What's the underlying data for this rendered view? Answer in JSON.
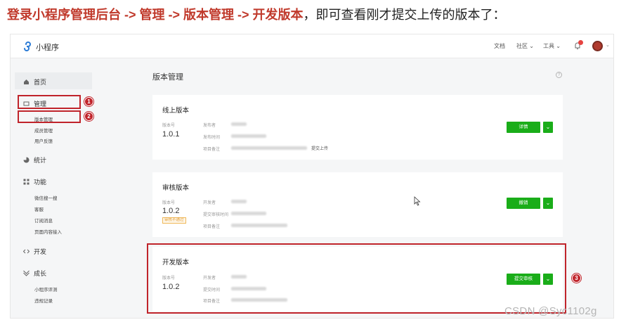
{
  "caption": {
    "part1": "登录小程序管理后台",
    "sep1": " -> ",
    "part2": "管理",
    "sep2": " -> ",
    "part3": "版本管理",
    "sep3": " -> ",
    "part4": "开发版本",
    "tail": "，即可查看刚才提交上传的版本了："
  },
  "topbar": {
    "brand": "小程序",
    "nav": [
      "文档",
      "社区",
      "工具"
    ]
  },
  "sidebar": {
    "home": "首页",
    "manage": "管理",
    "manage_sub": [
      "版本管理",
      "成员管理",
      "用户反馈"
    ],
    "stats": "统计",
    "features": "功能",
    "features_sub": [
      "微信搜一搜",
      "客服",
      "订阅消息",
      "页面内容接入"
    ],
    "dev": "开发",
    "growth": "成长",
    "growth_sub": [
      "小程序评测",
      "违规记录"
    ]
  },
  "main": {
    "title": "版本管理",
    "online": {
      "title": "线上版本",
      "ver_label": "版本号",
      "ver": "1.0.1",
      "fields": [
        "发布者",
        "发布时间",
        "项目备注"
      ],
      "note_suffix": "提交上传",
      "button": "详情"
    },
    "review": {
      "title": "审核版本",
      "ver_label": "版本号",
      "ver": "1.0.2",
      "badge": "审核不通过",
      "fields": [
        "开发者",
        "提交审核时间",
        "项目备注"
      ],
      "button": "撤销"
    },
    "dev": {
      "title": "开发版本",
      "ver_label": "版本号",
      "ver": "1.0.2",
      "fields": [
        "开发者",
        "提交时间",
        "项目备注"
      ],
      "button": "提交审核"
    }
  },
  "annotations": [
    "1",
    "2",
    "3"
  ],
  "watermark": "CSDN @Syc1102g",
  "colors": {
    "highlight": "#c0242b",
    "button_green": "#1aad19"
  }
}
